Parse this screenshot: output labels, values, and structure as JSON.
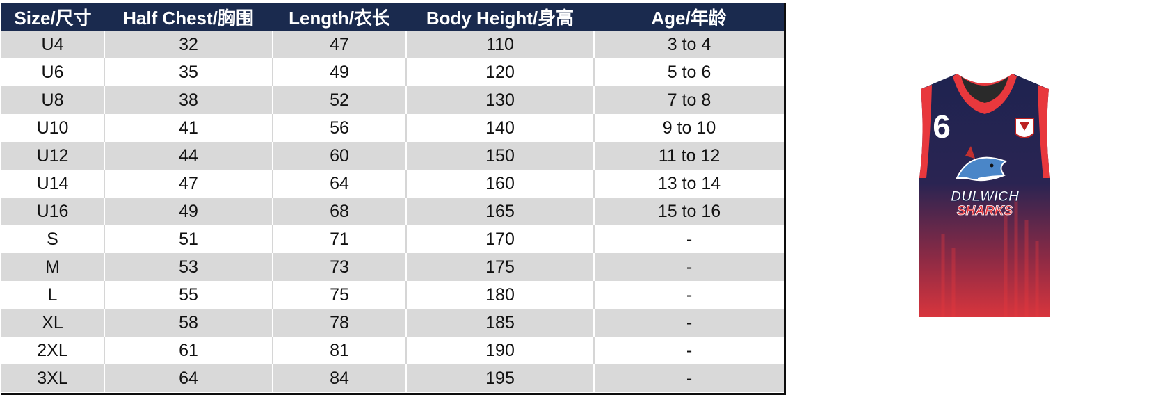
{
  "table": {
    "headers": [
      "Size/尺寸",
      "Half Chest/胸围",
      "Length/衣长",
      "Body Height/身高",
      "Age/年龄"
    ],
    "rows": [
      [
        "U4",
        "32",
        "47",
        "110",
        "3 to 4"
      ],
      [
        "U6",
        "35",
        "49",
        "120",
        "5 to 6"
      ],
      [
        "U8",
        "38",
        "52",
        "130",
        "7 to 8"
      ],
      [
        "U10",
        "41",
        "56",
        "140",
        "9 to 10"
      ],
      [
        "U12",
        "44",
        "60",
        "150",
        "11 to 12"
      ],
      [
        "U14",
        "47",
        "64",
        "160",
        "13 to 14"
      ],
      [
        "U16",
        "49",
        "68",
        "165",
        "15 to 16"
      ],
      [
        "S",
        "51",
        "71",
        "170",
        "-"
      ],
      [
        "M",
        "53",
        "73",
        "175",
        "-"
      ],
      [
        "L",
        "55",
        "75",
        "180",
        "-"
      ],
      [
        "XL",
        "58",
        "78",
        "185",
        "-"
      ],
      [
        "2XL",
        "61",
        "81",
        "190",
        "-"
      ],
      [
        "3XL",
        "64",
        "84",
        "195",
        "-"
      ]
    ]
  },
  "jersey": {
    "number": "6",
    "team_line1": "DULWICH",
    "team_line2": "SHARKS",
    "colors": {
      "navy": "#1e2350",
      "red": "#e23a3f",
      "trim": "#e8383d"
    }
  }
}
